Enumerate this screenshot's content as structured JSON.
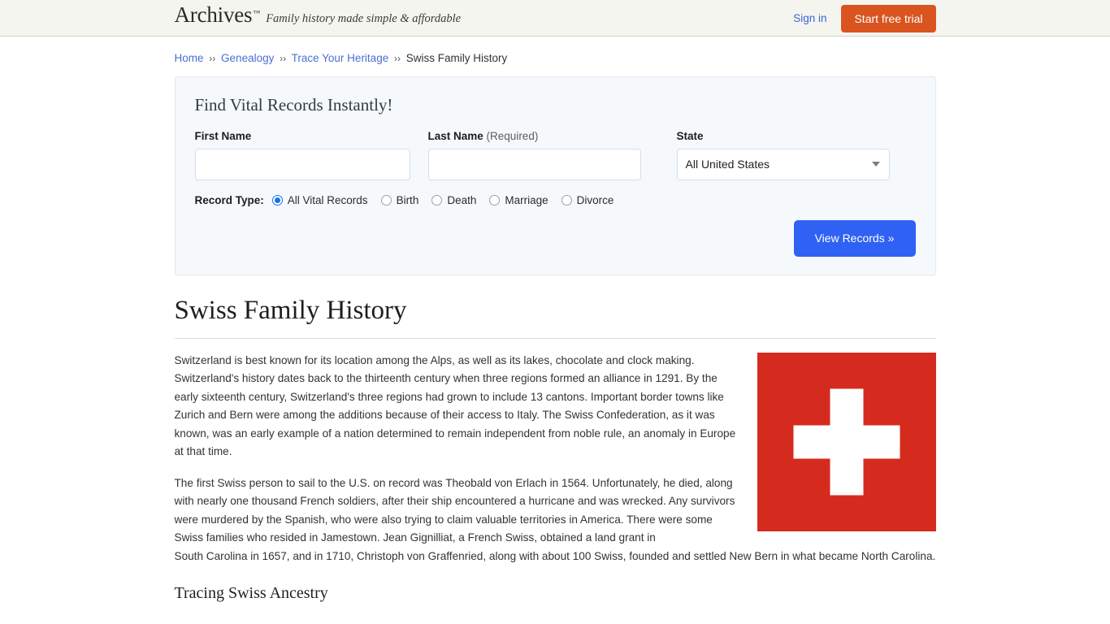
{
  "header": {
    "logo": "Archives",
    "logo_tm": "™",
    "tagline": "Family history made simple & affordable",
    "signin_label": "Sign in",
    "trial_label": "Start free trial",
    "brand_orange": "#d9541e",
    "bar_background": "#f5f5f0"
  },
  "breadcrumb": {
    "items": [
      {
        "label": "Home",
        "link": true
      },
      {
        "label": "Genealogy",
        "link": true
      },
      {
        "label": "Trace Your Heritage",
        "link": true
      },
      {
        "label": "Swiss Family History",
        "link": false
      }
    ],
    "separator": "››"
  },
  "search_form": {
    "title": "Find Vital Records Instantly!",
    "first_name": {
      "label": "First Name",
      "value": "",
      "placeholder": ""
    },
    "last_name": {
      "label": "Last Name",
      "required_note": "(Required)",
      "value": "",
      "placeholder": ""
    },
    "state": {
      "label": "State",
      "selected": "All United States",
      "caret_icon": "chevron-down-icon"
    },
    "record_type": {
      "label": "Record Type:",
      "selected": "All Vital Records",
      "options": [
        "All Vital Records",
        "Birth",
        "Death",
        "Marriage",
        "Divorce"
      ]
    },
    "submit_label": "View Records »",
    "submit_color": "#2f62f4",
    "panel_background": "#f6f9fc"
  },
  "article": {
    "title": "Swiss Family History",
    "flag": {
      "alt": "swiss-flag",
      "red": "#d52b1e",
      "cross": "#ffffff"
    },
    "paragraph_1": "Switzerland is best known for its location among the Alps, as well as its lakes, chocolate and clock making. Switzerland's history dates back to the thirteenth century when three regions formed an alliance in 1291. By the early sixteenth century, Switzerland's three regions had grown to include 13 cantons. Important border towns like Zurich and Bern were among the additions because of their access to Italy. The Swiss Confederation, as it was known, was an early example of a nation determined to remain independent from noble rule, an anomaly in Europe at that time.",
    "paragraph_2a": "The first Swiss person to sail to the U.S. on record was Theobald von Erlach in 1564. Unfortunately, he died, along with nearly one thousand French soldiers, after their ship encountered a hurricane and was wrecked. Any survivors were murdered by the Spanish, who were also trying to claim valuable territories in America. There were some Swiss families who resided in Jamestown. Jean Gignilliat, a French Swiss, obtained a land grant in",
    "paragraph_2b": "South Carolina in 1657, and in 1710, Christoph von Graffenried, along with about 100 Swiss, founded and settled New Bern in what became North Carolina.",
    "subheading": "Tracing Swiss Ancestry"
  }
}
